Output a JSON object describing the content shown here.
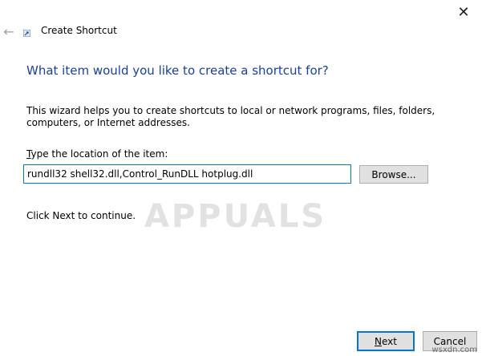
{
  "window": {
    "title": "Create Shortcut",
    "close_glyph": "✕",
    "back_glyph": "←"
  },
  "wizard": {
    "heading": "What item would you like to create a shortcut for?",
    "description": "This wizard helps you to create shortcuts to local or network programs, files, folders, computers, or Internet addresses.",
    "location_label_mnemonic": "T",
    "location_label_rest": "ype the location of the item:",
    "location_value": "rundll32 shell32.dll,Control_RunDLL hotplug.dll",
    "browse_label": "Browse...",
    "continue_text": "Click Next to continue."
  },
  "buttons": {
    "next_mnemonic": "N",
    "next_rest": "ext",
    "cancel": "Cancel"
  },
  "watermarks": {
    "brand": "APPUALS",
    "site": "wsxdn.com"
  },
  "colors": {
    "heading": "#1a3f9c",
    "focus_border": "#0078d7",
    "button_face": "#e1e1e1"
  },
  "icons": {
    "back": "arrow-left-icon",
    "close": "close-icon",
    "wizard": "shortcut-wizard-icon"
  }
}
